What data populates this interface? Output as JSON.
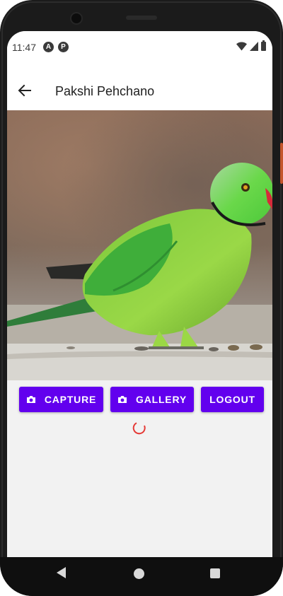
{
  "status_bar": {
    "time": "11:47",
    "icons": [
      "a-icon",
      "p-icon",
      "wifi-icon",
      "signal-icon",
      "battery-icon"
    ]
  },
  "app_bar": {
    "title": "Pakshi Pehchano",
    "back_icon": "arrow-back-icon"
  },
  "image": {
    "subject": "green parrot photo"
  },
  "buttons": {
    "capture": "CAPTURE",
    "gallery": "GALLERY",
    "logout": "LOGOUT"
  },
  "loading": {
    "icon": "spinner-icon"
  },
  "colors": {
    "primary": "#6200ee",
    "spinner": "#e53935",
    "screen_bg": "#f2f2f2"
  }
}
